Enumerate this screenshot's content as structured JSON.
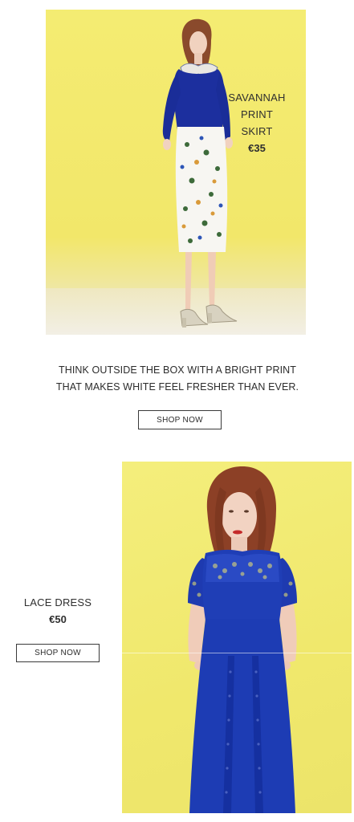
{
  "product_1": {
    "name_line_1": "SAVANNAH",
    "name_line_2": "PRINT SKIRT",
    "price": "€35",
    "image": "model-blue-top-bird-print-skirt"
  },
  "promo": {
    "line_1": "THINK OUTSIDE THE BOX WITH A BRIGHT PRINT",
    "line_2": "THAT MAKES WHITE FEEL FRESHER THAN EVER.",
    "button_label": "SHOP NOW"
  },
  "product_2": {
    "name": "LACE DRESS",
    "price": "€50",
    "button_label": "SHOP NOW",
    "image": "model-blue-lace-dress"
  },
  "colors": {
    "background_yellow": "#f2e96c",
    "garment_blue": "#1b3aa8",
    "text": "#2f2f2f",
    "button_border": "#3a3a3a"
  }
}
